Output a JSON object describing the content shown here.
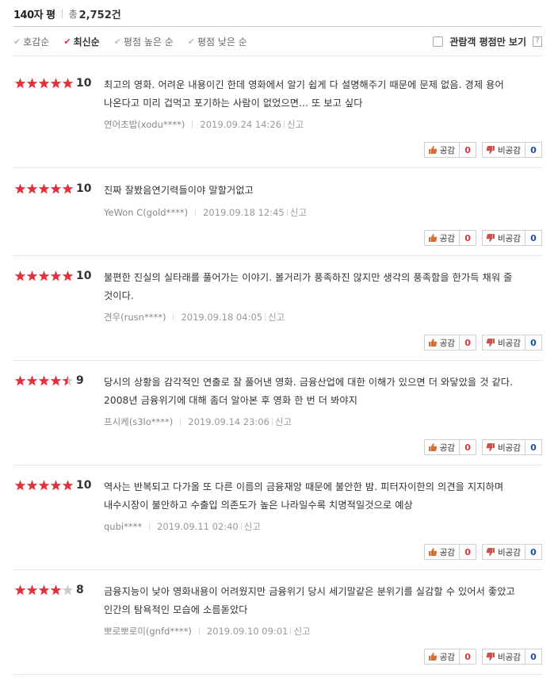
{
  "header": {
    "title": "140자 평",
    "total_label": "총",
    "total_count": "2,752건"
  },
  "sort": {
    "options": [
      {
        "label": "호감순",
        "active": false
      },
      {
        "label": "최신순",
        "active": true
      },
      {
        "label": "평점 높은 순",
        "active": false
      },
      {
        "label": "평점 낮은 순",
        "active": false
      }
    ],
    "audience_only_label": "관람객 평점만 보기",
    "help_glyph": "?"
  },
  "colors": {
    "star_on": "#e0323e",
    "star_off": "#cccccc",
    "like_count": "#e0323e",
    "dislike_count": "#1f4e9a"
  },
  "vote_labels": {
    "like": "공감",
    "dislike": "비공감"
  },
  "reviews": [
    {
      "score": "10",
      "rating": 10,
      "text": "최고의 영화. 어려운 내용이긴 한데 영화에서 알기 쉽게 다 설명해주기 때문에 문제 없음. 경제 용어 나온다고 미리 겁먹고 포기하는 사람이 없었으면... 또 보고 싶다",
      "author": "연어초밥(xodu****)",
      "date": "2019.09.24 14:26",
      "report": "신고",
      "likes": "0",
      "dislikes": "0"
    },
    {
      "score": "10",
      "rating": 10,
      "text": "진짜 잘봤음연기력들이야 말할거없고",
      "author": "YeWon C(gold****)",
      "date": "2019.09.18 12:45",
      "report": "신고",
      "likes": "0",
      "dislikes": "0"
    },
    {
      "score": "10",
      "rating": 10,
      "text": "불편한 진실의 실타래를 풀어가는 이야기. 볼거리가 풍족하진 않지만 생각의 풍족함을 한가득 채워 줄 것이다.",
      "author": "견우(rusn****)",
      "date": "2019.09.18 04:05",
      "report": "신고",
      "likes": "0",
      "dislikes": "0"
    },
    {
      "score": "9",
      "rating": 9,
      "text": "당시의 상황을 감각적인 연출로 잘 풀어낸 영화. 금융산업에 대한 이해가 있으면 더 와닿았을 것 같다. 2008년 금융위기에 대해 좀더 알아본 후 영화 한 번 더 봐야지",
      "author": "프시케(s3lo****)",
      "date": "2019.09.14 23:06",
      "report": "신고",
      "likes": "0",
      "dislikes": "0"
    },
    {
      "score": "10",
      "rating": 10,
      "text": "역사는 반복되고 다가올 또 다른 이름의 금융재앙 때문에 불안한 밤. 피터자이한의 의견을 지지하며 내수시장이 불안하고 수출입 의존도가 높은 나라일수록 치명적일것으로 예상",
      "author": "qubi****",
      "date": "2019.09.11 02:40",
      "report": "신고",
      "likes": "0",
      "dislikes": "0"
    },
    {
      "score": "8",
      "rating": 8,
      "text": "금융지능이 낮아 영화내용이 어려웠지만 금융위기 당시 세기말같은 분위기를 실감할 수 있어서 좋았고 인간의 탐욕적인 모습에 소름돋았다",
      "author": "뽀로뽀로미(gnfd****)",
      "date": "2019.09.10 09:01",
      "report": "신고",
      "likes": "0",
      "dislikes": "0"
    }
  ]
}
